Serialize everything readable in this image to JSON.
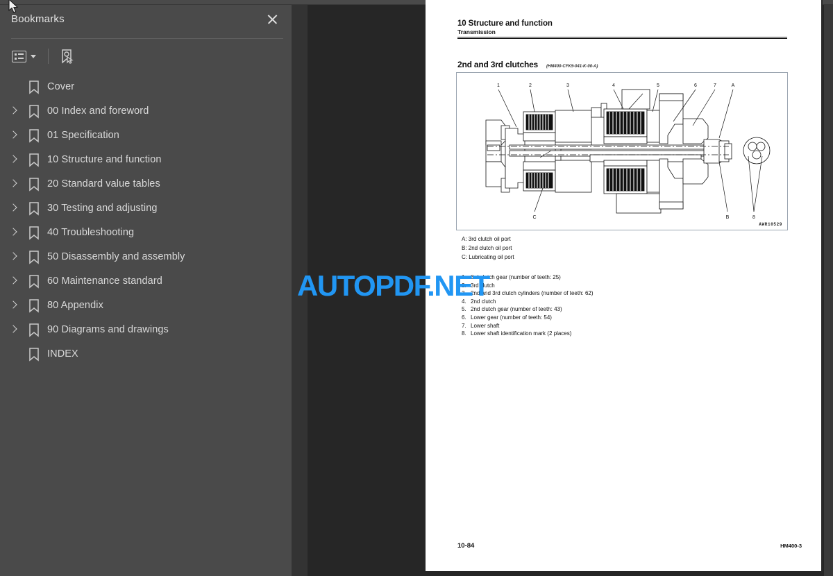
{
  "app": {
    "viewer_name": "pdf-viewer",
    "watermark": "AUTOPDF.NET",
    "watermark_color": "#2196f3",
    "sidebar_bg": "#4a4a4a",
    "canvas_bg": "#262626"
  },
  "sidebar": {
    "title": "Bookmarks",
    "close_label": "×",
    "toolbar": {
      "options_icon": "list-options-icon",
      "options_caret": "chevron-down-icon",
      "new_bookmark_icon": "new-bookmark-icon"
    },
    "items": [
      {
        "label": "Cover",
        "has_children": false
      },
      {
        "label": "00 Index and foreword",
        "has_children": true
      },
      {
        "label": "01 Specification",
        "has_children": true
      },
      {
        "label": "10 Structure and function",
        "has_children": true
      },
      {
        "label": "20 Standard value tables",
        "has_children": true
      },
      {
        "label": "30 Testing and adjusting",
        "has_children": true
      },
      {
        "label": "40 Troubleshooting",
        "has_children": true
      },
      {
        "label": "50 Disassembly and assembly",
        "has_children": true
      },
      {
        "label": "60 Maintenance standard",
        "has_children": true
      },
      {
        "label": "80 Appendix",
        "has_children": true
      },
      {
        "label": "90 Diagrams and drawings",
        "has_children": true
      },
      {
        "label": "INDEX",
        "has_children": false
      }
    ]
  },
  "page": {
    "chapter": "10 Structure and function",
    "section": "Transmission",
    "subtitle": "2nd and 3rd clutches",
    "subtitle_code": "(HM400-CFK9-041-K-00-A)",
    "figure_id": "AWR10529",
    "figure_alt": "Cross-section drawing of 2nd and 3rd clutches assembly",
    "ports": [
      "A: 3rd clutch oil port",
      "B: 2nd clutch oil port",
      "C: Lubricating oil port"
    ],
    "items": [
      {
        "num": "1.",
        "text": "3rd clutch gear (number of teeth: 25)"
      },
      {
        "num": "2.",
        "text": "3rd clutch"
      },
      {
        "num": "3.",
        "text": "2nd and 3rd clutch cylinders (number of teeth: 62)"
      },
      {
        "num": "4.",
        "text": "2nd clutch"
      },
      {
        "num": "5.",
        "text": "2nd clutch gear (number of teeth: 43)"
      },
      {
        "num": "6.",
        "text": "Lower gear (number of teeth: 54)"
      },
      {
        "num": "7.",
        "text": "Lower shaft"
      },
      {
        "num": "8.",
        "text": "Lower shaft identification mark (2 places)"
      }
    ],
    "footer_page": "10-84",
    "footer_model": "HM400-3"
  }
}
